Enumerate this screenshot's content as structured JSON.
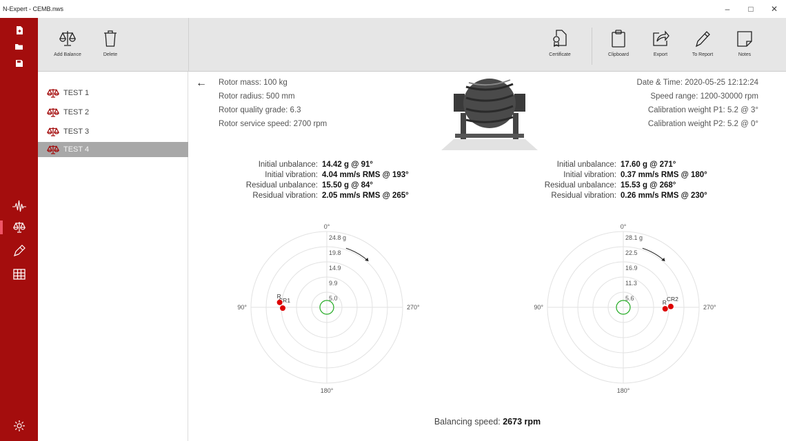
{
  "window": {
    "title": "N-Expert - CEMB.nws",
    "minimize": "–",
    "maximize": "□",
    "close": "✕"
  },
  "rail": {
    "icons": [
      "new-file-icon",
      "open-folder-icon",
      "save-icon",
      "waveform-icon",
      "balance-icon",
      "pen-icon",
      "table-icon",
      "settings-icon"
    ],
    "selected": "balance-icon"
  },
  "toolbar": {
    "add_balance": "Add Balance",
    "delete": "Delete",
    "certificate": "Certificate",
    "clipboard": "Clipboard",
    "export": "Export",
    "to_report": "To Report",
    "notes": "Notes"
  },
  "tests": [
    {
      "label": "TEST 1"
    },
    {
      "label": "TEST 2"
    },
    {
      "label": "TEST 3"
    },
    {
      "label": "TEST 4",
      "selected": true
    }
  ],
  "info": {
    "rotor_mass": "Rotor mass: 100 kg",
    "rotor_radius": "Rotor radius: 500 mm",
    "quality_grade": "Rotor quality grade: 6.3",
    "service_speed": "Rotor service speed: 2700 rpm",
    "datetime": "Date & Time: 2020-05-25 12:12:24",
    "speed_range": "Speed range: 1200-30000 rpm",
    "calib_p1": "Calibration weight P1: 5.2 @ 3°",
    "calib_p2": "Calibration weight P2: 5.2 @ 0°"
  },
  "planes": [
    {
      "initial_unbalance_label": "Initial unbalance:",
      "initial_unbalance": "14.42 g @ 91°",
      "initial_vibration_label": "Initial vibration:",
      "initial_vibration": "4.04 mm/s RMS @ 193°",
      "residual_unbalance_label": "Residual unbalance:",
      "residual_unbalance": "15.50 g @ 84°",
      "residual_vibration_label": "Residual vibration:",
      "residual_vibration": "2.05 mm/s RMS @ 265°",
      "polar": {
        "angle_labels": {
          "top": "0°",
          "left": "90°",
          "right": "270°",
          "bottom": "180°"
        },
        "rings": [
          "24.8 g",
          "19.8",
          "14.9",
          "9.9",
          "5.0"
        ],
        "max": 24.8,
        "points": [
          {
            "label": "CR1",
            "magnitude": 14.42,
            "angle": 91
          },
          {
            "label": "R",
            "magnitude": 15.5,
            "angle": 84
          }
        ]
      }
    },
    {
      "initial_unbalance_label": "Initial unbalance:",
      "initial_unbalance": "17.60 g @ 271°",
      "initial_vibration_label": "Initial vibration:",
      "initial_vibration": "0.37 mm/s RMS @ 180°",
      "residual_unbalance_label": "Residual unbalance:",
      "residual_unbalance": "15.53 g @ 268°",
      "residual_vibration_label": "Residual vibration:",
      "residual_vibration": "0.26 mm/s RMS @ 230°",
      "polar": {
        "angle_labels": {
          "top": "0°",
          "left": "90°",
          "right": "270°",
          "bottom": "180°"
        },
        "rings": [
          "28.1 g",
          "22.5",
          "16.9",
          "11.3",
          "5.6"
        ],
        "max": 28.1,
        "points": [
          {
            "label": "CR2",
            "magnitude": 17.6,
            "angle": 271
          },
          {
            "label": "R",
            "magnitude": 15.53,
            "angle": 268
          }
        ]
      }
    }
  ],
  "balancing_speed_label": "Balancing speed:",
  "balancing_speed": "2673 rpm",
  "colors": {
    "accent": "#a40d0d",
    "point": "#dd0000",
    "center": "#22aa22"
  }
}
